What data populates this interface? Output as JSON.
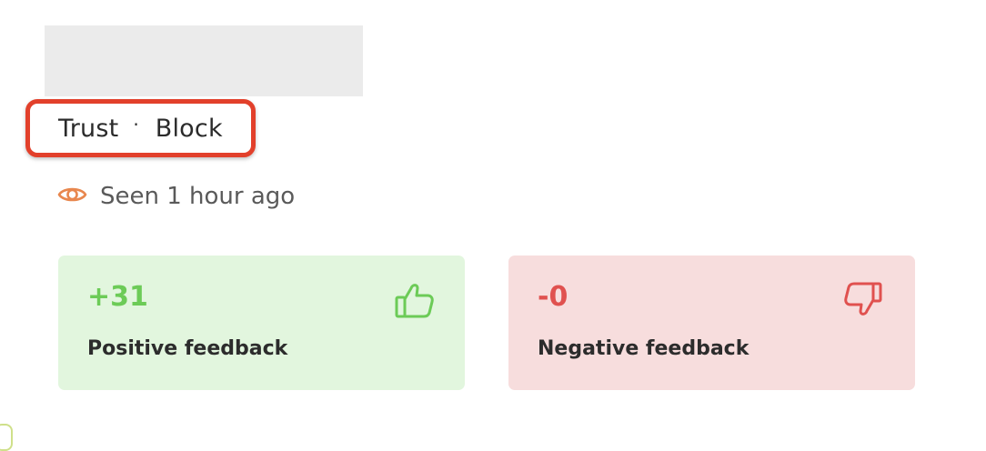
{
  "actions": {
    "trust_label": "Trust",
    "separator": "·",
    "block_label": "Block",
    "highlight_color": "#e2402b"
  },
  "presence": {
    "icon": "eye-icon",
    "icon_color": "#e8874e",
    "text": "Seen 1 hour ago"
  },
  "feedback": {
    "positive": {
      "count": "+31",
      "label": "Positive feedback",
      "icon": "thumbs-up-icon",
      "accent_color": "#6ccb57",
      "background_color": "#e2f6de"
    },
    "negative": {
      "count": "-0",
      "label": "Negative feedback",
      "icon": "thumbs-down-icon",
      "accent_color": "#e0514f",
      "background_color": "#f7dddd"
    }
  }
}
